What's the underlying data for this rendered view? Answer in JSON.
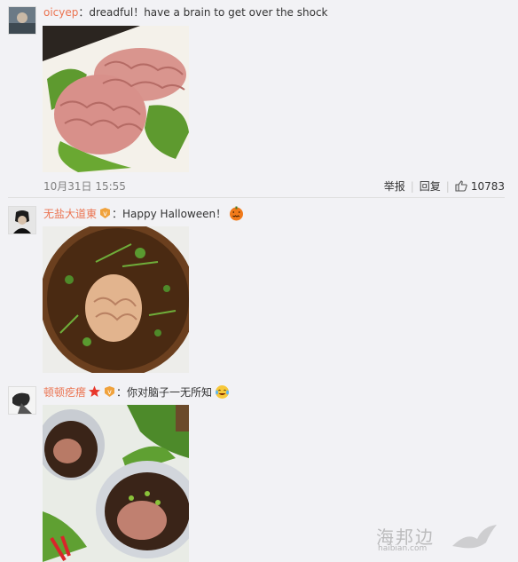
{
  "comments": [
    {
      "author": "oicyep",
      "separator": "：",
      "text": "dreadful！have a brain to get over the shock",
      "time": "10月31日 15:55",
      "report_label": "举报",
      "reply_label": "回复",
      "like_count": "10783"
    },
    {
      "author": "无盐大道東",
      "separator": "：",
      "text": "Happy Halloween！"
    },
    {
      "author": "顿顿疙瘩",
      "separator": "：",
      "text": "你对脑子一无所知"
    }
  ],
  "watermark": {
    "brand": "海邦边",
    "domain": "haibian.com"
  },
  "colors": {
    "author": "#eb7350",
    "background": "#f2f2f5"
  }
}
